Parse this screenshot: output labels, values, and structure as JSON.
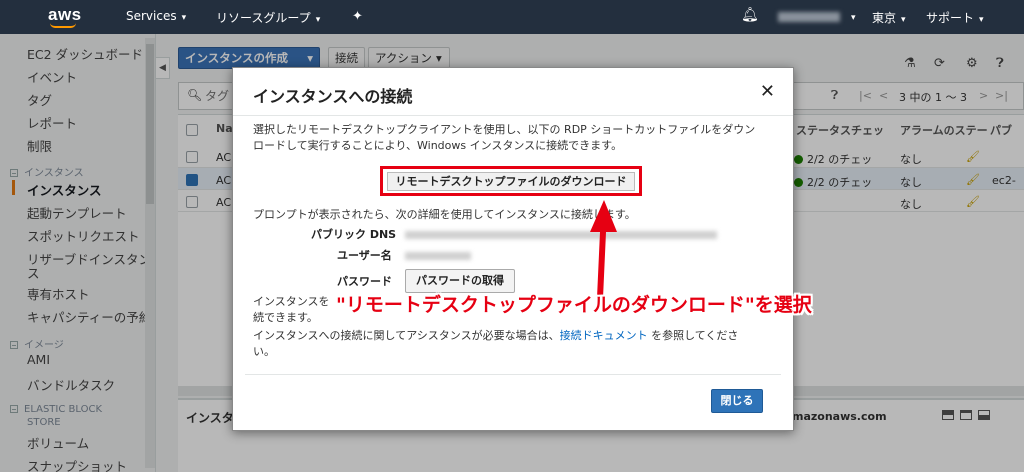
{
  "topbar": {
    "logo": "aws",
    "services": "Services",
    "resource_groups": "リソースグループ",
    "pin_icon": "pin-icon",
    "bell_icon": "bell-icon",
    "region": "東京",
    "support": "サポート"
  },
  "sidebar": {
    "items": [
      {
        "label": "EC2 ダッシュボード"
      },
      {
        "label": "イベント"
      },
      {
        "label": "タグ"
      },
      {
        "label": "レポート"
      },
      {
        "label": "制限"
      }
    ],
    "section_instances": "インスタンス",
    "instance_items": [
      {
        "label": "インスタンス",
        "active": true
      },
      {
        "label": "起動テンプレート"
      },
      {
        "label": "スポットリクエスト"
      },
      {
        "label": "リザーブドインスタンス"
      },
      {
        "label": "ス"
      },
      {
        "label": "専有ホスト"
      },
      {
        "label": "キャパシティーの予約"
      }
    ],
    "section_images": "イメージ",
    "image_items": [
      {
        "label": "AMI"
      },
      {
        "label": "バンドルタスク"
      }
    ],
    "section_ebs": "ELASTIC BLOCK",
    "section_ebs_2": "STORE",
    "ebs_items": [
      {
        "label": "ボリューム"
      },
      {
        "label": "スナップショット"
      }
    ]
  },
  "toolbar": {
    "create_instance": "インスタンスの作成",
    "connect": "接続",
    "actions": "アクション",
    "pagination": "3 中の 1 ～ 3"
  },
  "search": {
    "placeholder": "タグ"
  },
  "table": {
    "headers": {
      "name": "Na",
      "status_check": "ステータスチェッ",
      "alarm_status": "アラームのステー",
      "public": "パブ"
    },
    "rows": [
      {
        "name": "AC",
        "check": "2/2 のチェッ",
        "alarm": "なし",
        "public": "",
        "selected": false
      },
      {
        "name": "AC",
        "check": "2/2 のチェッ",
        "alarm": "なし",
        "public": "ec2-",
        "selected": true
      },
      {
        "name": "AC",
        "check": "",
        "alarm": "なし",
        "public": "",
        "selected": false
      }
    ]
  },
  "bottom_panel": {
    "title": "インスタ",
    "dns_suffix": "mazonaws.com"
  },
  "modal": {
    "title": "インスタンスへの接続",
    "close_icon": "close-icon",
    "intro_line1": "選択したリモートデスクトップクライアントを使用し、以下の RDP ショートカットファイルをダウン",
    "intro_line2": "ロードして実行することにより、Windows インスタンスに接続できます。",
    "download_button": "リモートデスクトップファイルのダウンロード",
    "prompt_text": "プロンプトが表示されたら、次の詳細を使用してインスタンスに接続します。",
    "public_dns_label": "パブリック DNS",
    "username_label": "ユーザー名",
    "password_label": "パスワード",
    "get_password_button": "パスワードの取得",
    "note_line1": "インスタンスを",
    "note_line2": "続できます。",
    "help_prefix": "インスタンスへの接続に関してアシスタンスが必要な場合は、",
    "help_link": "接続ドキュメント",
    "help_suffix": " を参照してくださ",
    "help_line2": "い。",
    "close_button": "閉じる"
  },
  "annotation": {
    "text": "\"リモートデスクトップファイルのダウンロード\"を選択"
  },
  "colors": {
    "topbar_bg": "#232f3e",
    "highlight_red": "#e60012",
    "primary_blue": "#2e73b8",
    "accent_orange": "#e47911"
  }
}
